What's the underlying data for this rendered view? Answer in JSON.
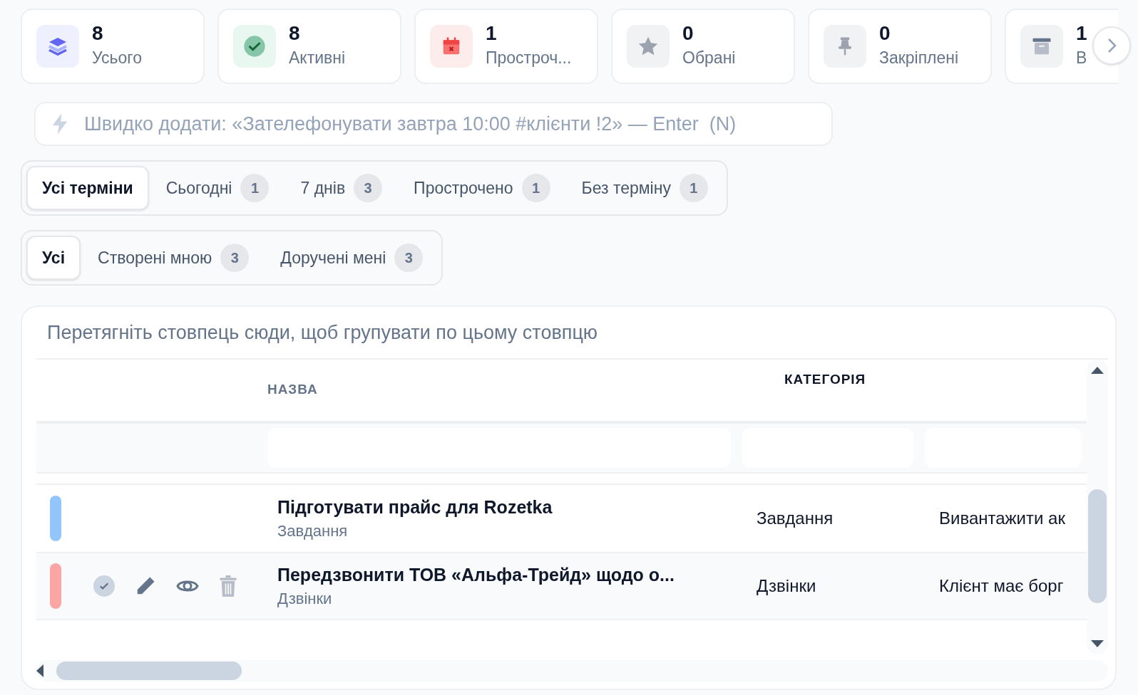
{
  "stats": [
    {
      "kind": "total",
      "value": "8",
      "label": "Усього"
    },
    {
      "kind": "active",
      "value": "8",
      "label": "Активні"
    },
    {
      "kind": "overdue",
      "value": "1",
      "label": "Простроч..."
    },
    {
      "kind": "favorite",
      "value": "0",
      "label": "Обрані"
    },
    {
      "kind": "pinned",
      "value": "0",
      "label": "Закріплені"
    },
    {
      "kind": "archived",
      "value": "1",
      "label": "В"
    }
  ],
  "quick_add": {
    "placeholder": "Швидко додати: «Зателефонувати завтра 10:00 #клієнти !2» — Enter  (N)"
  },
  "period_tabs": [
    {
      "label": "Усі терміни",
      "selected": true
    },
    {
      "label": "Сьогодні",
      "count": "1",
      "selected": false
    },
    {
      "label": "7 днів",
      "count": "3",
      "selected": false
    },
    {
      "label": "Прострочено",
      "count": "1",
      "selected": false
    },
    {
      "label": "Без терміну",
      "count": "1",
      "selected": false
    }
  ],
  "owner_tabs": [
    {
      "label": "Усі",
      "selected": true
    },
    {
      "label": "Створені мною",
      "count": "3",
      "selected": false
    },
    {
      "label": "Доручені мені",
      "count": "3",
      "selected": false
    }
  ],
  "table": {
    "group_hint": "Перетягніть стовпець сюди, щоб групувати по цьому стовпцю",
    "columns": [
      "НАЗВА",
      "КАТЕГОРІЯ"
    ],
    "rows": [
      {
        "color": "#93c5fd",
        "hovered": false,
        "title": "Підготувати прайс для Rozetka",
        "subtitle": "Завдання",
        "category": "Завдання",
        "column_3": "Вивантажити ак"
      },
      {
        "color": "#fca5a5",
        "hovered": true,
        "title": "Передзвонити ТОВ «Альфа-Трейд» щодо о...",
        "subtitle": "Дзвінки",
        "category": "Дзвінки",
        "column_3": "Клієнт має борг"
      }
    ]
  }
}
